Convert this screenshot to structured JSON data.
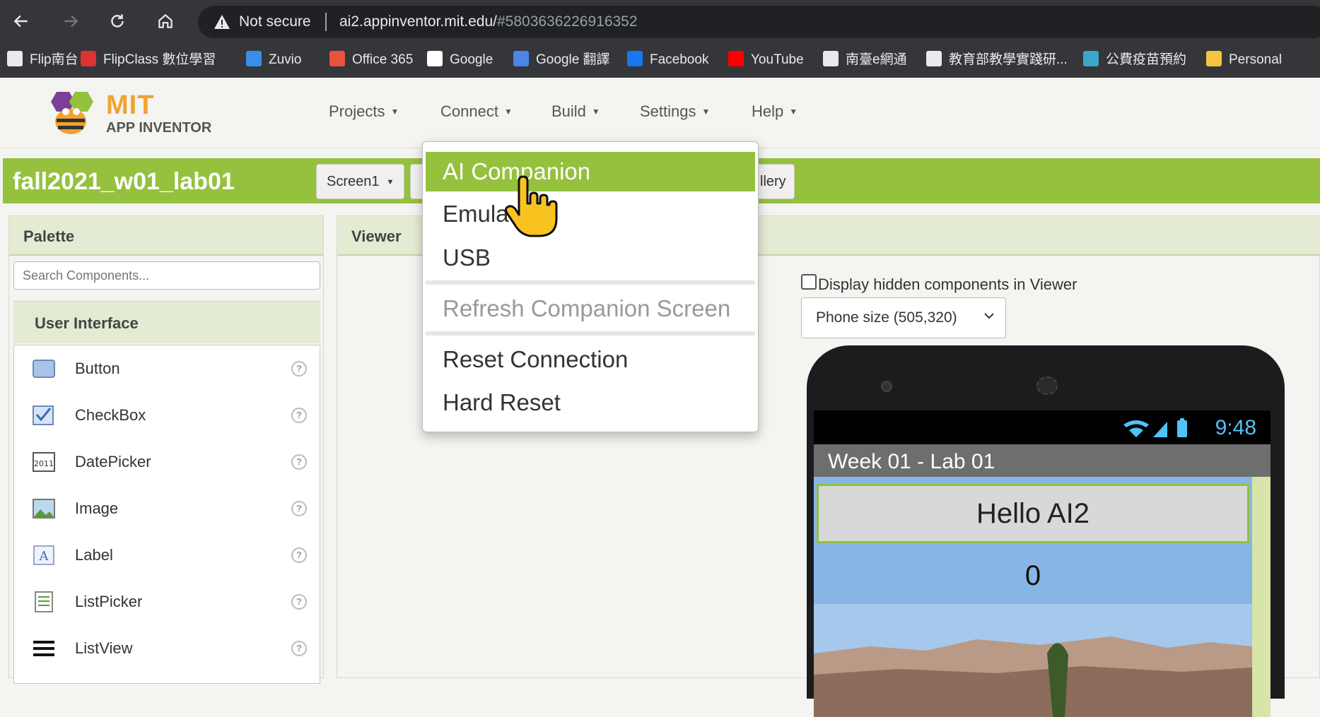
{
  "browser": {
    "security_label": "Not secure",
    "url_host": "ai2.appinventor.mit.edu/",
    "url_rest": "#5803636226916352",
    "bookmarks": [
      {
        "label": "Flip南台",
        "icon": "page-icon",
        "color": "#e8eaed"
      },
      {
        "label": "FlipClass 數位學習",
        "icon": "flipclass-icon",
        "color": "#d33"
      },
      {
        "label": "Zuvio",
        "icon": "zuvio-icon",
        "color": "#3b8ee8"
      },
      {
        "label": "Office 365",
        "icon": "office-icon",
        "color": "#e8533b"
      },
      {
        "label": "Google",
        "icon": "google-icon",
        "color": "#ffffff"
      },
      {
        "label": "Google 翻譯",
        "icon": "google-translate-icon",
        "color": "#4a86e8"
      },
      {
        "label": "Facebook",
        "icon": "facebook-icon",
        "color": "#1877f2"
      },
      {
        "label": "YouTube",
        "icon": "youtube-icon",
        "color": "#ff0000"
      },
      {
        "label": "南臺e網通",
        "icon": "page-icon",
        "color": "#e8eaed"
      },
      {
        "label": "教育部教學實踐研...",
        "icon": "page-icon",
        "color": "#e8eaed"
      },
      {
        "label": "公費疫苗預約",
        "icon": "vaccine-icon",
        "color": "#3aa6c8"
      },
      {
        "label": "Personal",
        "icon": "folder-icon",
        "color": "#f5c542"
      }
    ]
  },
  "app": {
    "logo_mit": "MIT",
    "logo_sub": "APP INVENTOR",
    "menus": [
      "Projects",
      "Connect",
      "Build",
      "Settings",
      "Help"
    ],
    "project_name": "fall2021_w01_lab01",
    "screen_select": "Screen1",
    "partial_button": "llery",
    "accent": "#95c13e"
  },
  "palette": {
    "title": "Palette",
    "search_placeholder": "Search Components...",
    "section": "User Interface",
    "components": [
      "Button",
      "CheckBox",
      "DatePicker",
      "Image",
      "Label",
      "ListPicker",
      "ListView"
    ]
  },
  "viewer": {
    "title": "Viewer",
    "hidden_label": "Display hidden components in Viewer",
    "phone_size": "Phone size (505,320)",
    "phone": {
      "time": "9:48",
      "screen_title": "Week 01 - Lab 01",
      "button_text": "Hello AI2",
      "counter": "0"
    }
  },
  "connect_menu": {
    "items": [
      "AI Companion",
      "Emulator",
      "USB",
      "Refresh Companion Screen",
      "Reset Connection",
      "Hard Reset"
    ],
    "active": "AI Companion",
    "disabled": "Refresh Companion Screen"
  }
}
